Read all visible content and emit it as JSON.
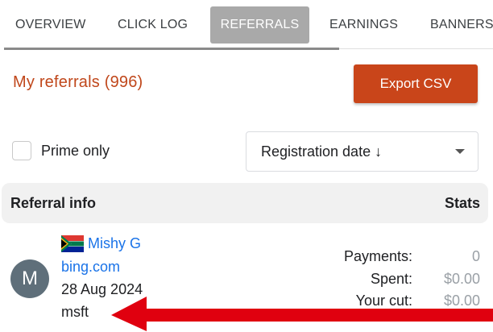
{
  "tabs": [
    {
      "label": "OVERVIEW"
    },
    {
      "label": "CLICK LOG"
    },
    {
      "label": "REFERRALS"
    },
    {
      "label": "EARNINGS"
    },
    {
      "label": "BANNERS"
    }
  ],
  "active_tab": "REFERRALS",
  "header": {
    "title": "My referrals (996)",
    "export_label": "Export CSV"
  },
  "filters": {
    "prime_only_label": "Prime only",
    "prime_only_checked": false,
    "sort_value": "Registration date ↓"
  },
  "table": {
    "col_left": "Referral info",
    "col_right": "Stats"
  },
  "referral": {
    "avatar_letter": "M",
    "flag": "south-africa-flag",
    "name": "Mishy G",
    "source": "bing.com",
    "date": "28 Aug 2024",
    "tag": "msft",
    "stats": [
      {
        "label": "Payments:",
        "value": "0"
      },
      {
        "label": "Spent:",
        "value": "$0.00"
      },
      {
        "label": "Your cut:",
        "value": "$0.00"
      }
    ]
  },
  "colors": {
    "accent": "#c9451a",
    "link": "#1a73e8",
    "active_tab_bg": "#a9a9a9",
    "arrow": "#e0000f"
  }
}
